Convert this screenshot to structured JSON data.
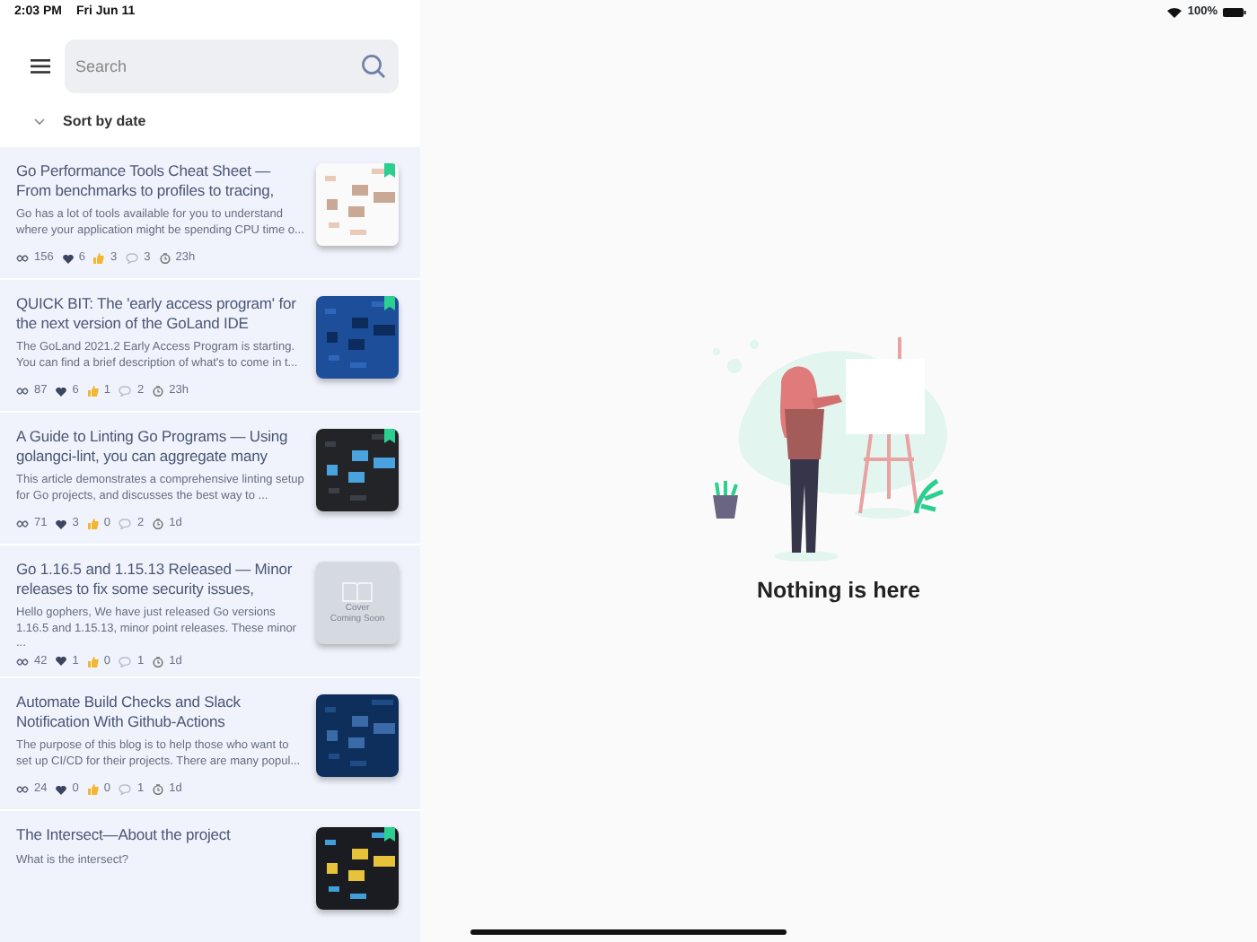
{
  "status_bar": {
    "time": "2:03 PM",
    "date": "Fri Jun 11",
    "battery": "100%"
  },
  "search": {
    "placeholder": "Search"
  },
  "sort": {
    "label": "Sort by date"
  },
  "articles": [
    {
      "title": "Go Performance Tools Cheat Sheet — From benchmarks to profiles to tracing,",
      "summary": "Go has a lot of tools available for you to understand where your application might be spending CPU time o...",
      "stats": {
        "views": "156",
        "likes": "6",
        "claps": "3",
        "comments": "3",
        "age": "23h"
      },
      "bookmarked": true
    },
    {
      "title": "QUICK BIT:  The 'early access program' for the next version of the GoLand IDE",
      "summary": "The GoLand 2021.2 Early Access Program is starting. You can find a brief description of what's to come in t...",
      "stats": {
        "views": "87",
        "likes": "6",
        "claps": "1",
        "comments": "2",
        "age": "23h"
      },
      "bookmarked": true
    },
    {
      "title": "A Guide to Linting Go Programs — Using golangci-lint, you can aggregate many",
      "summary": "This article demonstrates a comprehensive linting setup for Go projects, and discusses the best way to ...",
      "stats": {
        "views": "71",
        "likes": "3",
        "claps": "0",
        "comments": "2",
        "age": "1d"
      },
      "bookmarked": true
    },
    {
      "title": "Go 1.16.5 and 1.15.13 Released — Minor releases to fix some security issues,",
      "summary": "Hello gophers, We have just released Go versions 1.16.5 and 1.15.13, minor point releases. These minor ...",
      "stats": {
        "views": "42",
        "likes": "1",
        "claps": "0",
        "comments": "1",
        "age": "1d"
      },
      "bookmarked": false,
      "cover": {
        "kind": "placeholder",
        "line_1": "Cover",
        "line_2": "Coming Soon"
      }
    },
    {
      "title": "Automate Build Checks and Slack Notification With Github-Actions",
      "summary": "The purpose of this blog is to help those who want to set up CI/CD for their projects. There are many popul...",
      "stats": {
        "views": "24",
        "likes": "0",
        "claps": "0",
        "comments": "1",
        "age": "1d"
      },
      "bookmarked": false
    },
    {
      "title": "The Intersect—About the project",
      "summary": "What is the intersect?",
      "bookmarked": true
    }
  ],
  "empty_state": {
    "message": "Nothing is here"
  }
}
